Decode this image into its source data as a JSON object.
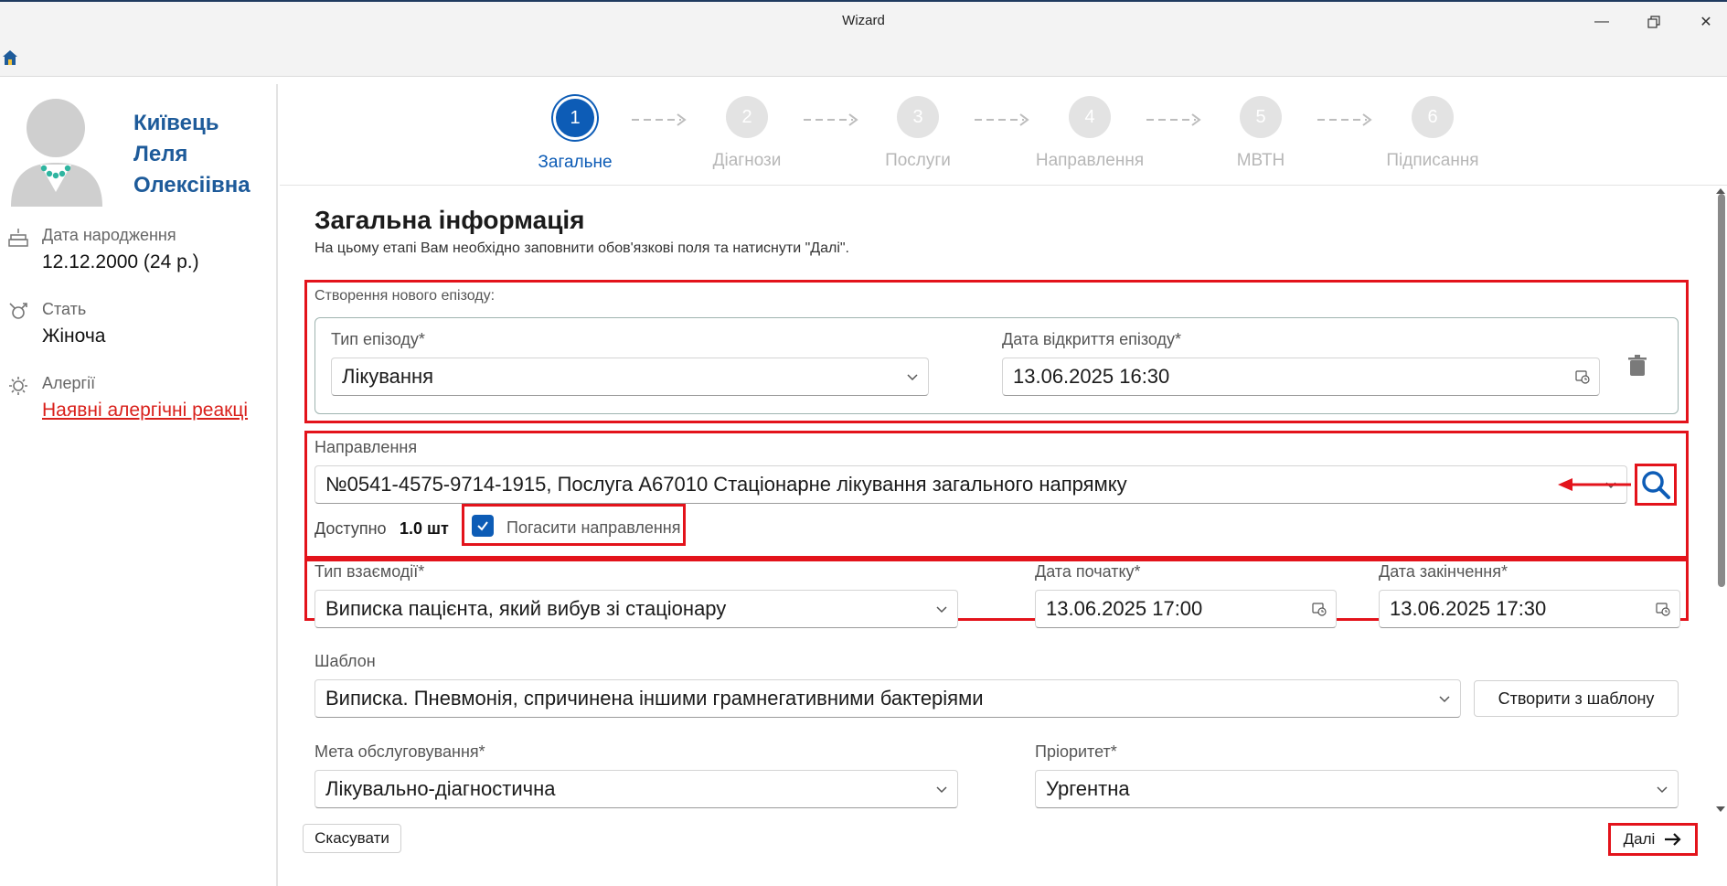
{
  "window": {
    "title": "Wizard"
  },
  "patient": {
    "name_line1": "Київець",
    "name_line2": "Леля",
    "name_line3": "Олексіівна",
    "birth_label": "Дата народження",
    "birth_value": "12.12.2000 (24 р.)",
    "sex_label": "Стать",
    "sex_value": "Жіноча",
    "allergy_label": "Алергії",
    "allergy_link": "Наявні алергічні реакці"
  },
  "steps": [
    {
      "num": "1",
      "label": "Загальне",
      "active": true
    },
    {
      "num": "2",
      "label": "Діагнози",
      "active": false
    },
    {
      "num": "3",
      "label": "Послуги",
      "active": false
    },
    {
      "num": "4",
      "label": "Направлення",
      "active": false
    },
    {
      "num": "5",
      "label": "МВТН",
      "active": false
    },
    {
      "num": "6",
      "label": "Підписання",
      "active": false
    }
  ],
  "form": {
    "title": "Загальна інформація",
    "subtitle": "На цьому етапі Вам необхідно заповнити обов'язкові поля та натиснути \"Далі\".",
    "new_episode_label": "Створення нового епізоду:",
    "episode_type_label": "Тип епізоду*",
    "episode_type_value": "Лікування",
    "episode_date_label": "Дата відкриття епізоду*",
    "episode_date_value": "13.06.2025 16:30",
    "referral_label": "Направлення",
    "referral_value": "№0541-4575-9714-1915, Послуга A67010 Стаціонарне лікування загального напрямку",
    "available_label": "Доступно",
    "available_value": "1.0 шт",
    "redeem_label": "Погасити направлення",
    "interaction_type_label": "Тип взаємодії*",
    "interaction_type_value": "Виписка пацієнта, який вибув зі стаціонару",
    "start_date_label": "Дата початку*",
    "start_date_value": "13.06.2025 17:00",
    "end_date_label": "Дата закінчення*",
    "end_date_value": "13.06.2025 17:30",
    "template_label": "Шаблон",
    "template_value": "Виписка. Пневмонія, спричинена іншими грамнегативними бактеріями",
    "create_from_template": "Створити з шаблону",
    "purpose_label": "Мета обслуговування*",
    "purpose_value": "Лікувально-діагностична",
    "priority_label": "Пріоритет*",
    "priority_value": "Ургентна",
    "cancel_button": "Скасувати",
    "next_button": "Далі"
  },
  "colors": {
    "accent": "#0d5cb6",
    "highlight": "#e3131b",
    "name": "#1e5b9a",
    "link": "#d9211c"
  }
}
